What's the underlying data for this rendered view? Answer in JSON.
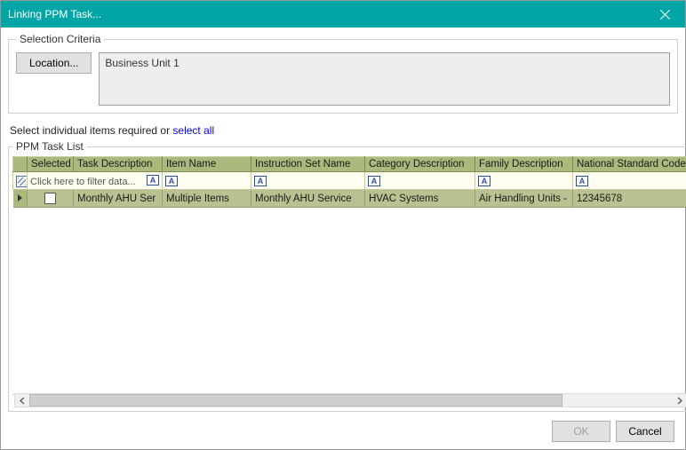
{
  "window": {
    "title": "Linking PPM Task..."
  },
  "criteria": {
    "legend": "Selection Criteria",
    "location_button": "Location...",
    "location_value": "Business Unit 1"
  },
  "instruction": {
    "prefix": "Select individual items required or ",
    "link": "select all"
  },
  "tasklist": {
    "legend": "PPM Task List",
    "headers": {
      "selected": "Selected",
      "task_description": "Task Description",
      "item_name": "Item Name",
      "instruction_set": "Instruction Set Name",
      "category": "Category Description",
      "family": "Family Description",
      "national_code": "National Standard Code"
    },
    "filter_hint": "Click here to filter data...",
    "filter_mode_glyph": "A",
    "rows": [
      {
        "selected": false,
        "task_description": "Monthly AHU Ser",
        "item_name": "Multiple Items",
        "instruction_set": "Monthly AHU Service",
        "category": "HVAC Systems",
        "family": "Air Handling Units -",
        "national_code": "12345678"
      }
    ]
  },
  "buttons": {
    "ok": "OK",
    "cancel": "Cancel"
  }
}
